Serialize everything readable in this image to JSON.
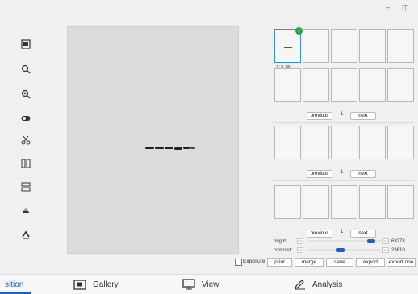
{
  "window": {
    "minimize_glyph": "–",
    "restore_glyph": "◫"
  },
  "toolbar": {
    "icons": [
      "image-icon",
      "zoom-out-icon",
      "zoom-in-icon",
      "toggle-icon",
      "cut-icon",
      "split-vertical-icon",
      "split-horizontal-icon",
      "flip-icon",
      "rotate-icon"
    ]
  },
  "thumbnails": {
    "first_label": "7 : 0 : 65"
  },
  "pager1": {
    "previous": "previous",
    "page": "1",
    "next": "next"
  },
  "pager2": {
    "previous": "previous",
    "page": "1",
    "next": "next"
  },
  "pager3": {
    "previous": "previous",
    "page": "1",
    "next": "next"
  },
  "adjust": {
    "bright_label": "bright:",
    "bright_value": "63273",
    "bright_level": 0.92,
    "contrast_label": "contrast:",
    "contrast_value": "23610",
    "contrast_level": 0.45,
    "left_arrow": "<<",
    "right_arrow": ">>"
  },
  "actions": {
    "exposure_label": "Exposure",
    "print": "print",
    "merge": "merge",
    "save": "save",
    "export": "export",
    "export_one": "export one"
  },
  "tabs": {
    "acquisition": "sition",
    "gallery": "Gallery",
    "view": "View",
    "analysis": "Analysis"
  },
  "colors": {
    "accent": "#1f5fbf",
    "selected_check": "#1fa34a",
    "blot_bg": "#dcdcdc"
  }
}
